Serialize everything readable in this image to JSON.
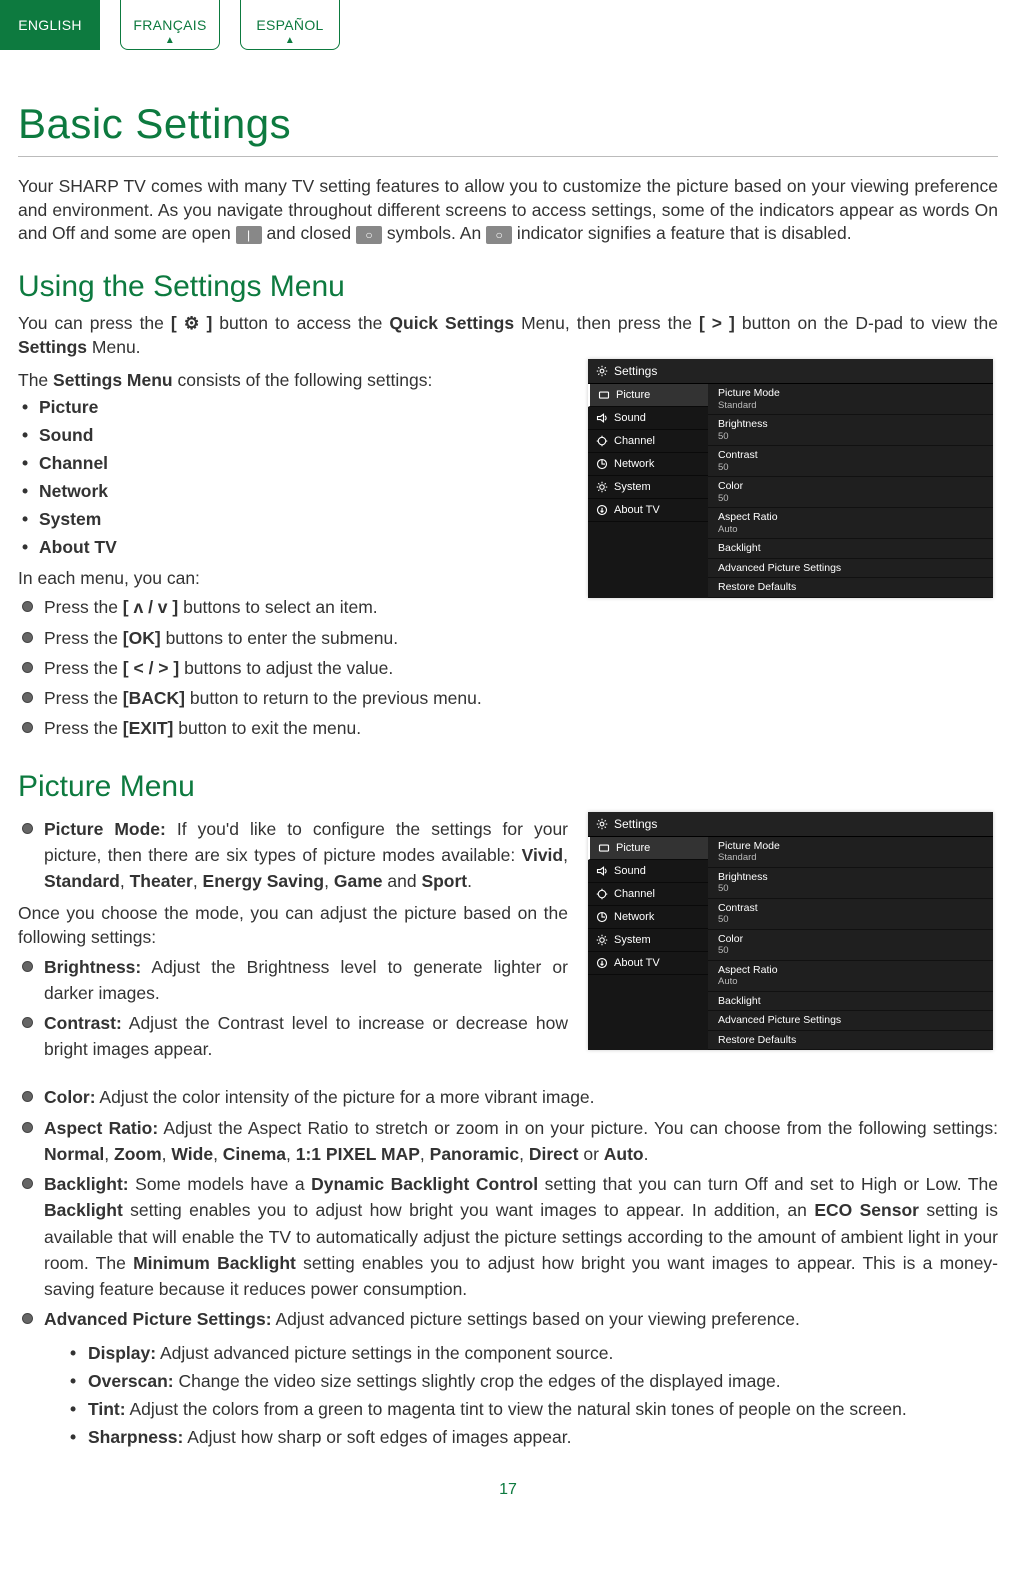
{
  "langs": {
    "en": "ENGLISH",
    "fr": "FRANÇAIS",
    "es": "ESPAÑOL"
  },
  "title": "Basic Settings",
  "intro1a": "Your SHARP TV comes with many TV setting features to allow you to customize the picture based on your viewing preference and environment. As you navigate throughout different screens to access settings, some of the indicators appear as words On and Off and some are open ",
  "intro1b": " and closed ",
  "intro1c": " symbols. An ",
  "intro1d": " indicator signifies a feature that is disabled.",
  "ind_open": "|",
  "ind_closed": "○",
  "ind_disabled": "○",
  "sect1": "Using the Settings Menu",
  "p1a": "You can press the ",
  "p1b": " button to access the ",
  "p1c": " Menu, then press the ",
  "p1d": " button on the D-pad to view the ",
  "p1e": " Menu.",
  "quick": "Quick Settings",
  "rightbtn": "[ > ]",
  "settings_b": "Settings",
  "gear_b": "[ ⚙ ]",
  "p2a": "The ",
  "p2b": "Settings Menu",
  "p2c": " consists of the following settings:",
  "mlist": [
    "Picture",
    "Sound",
    "Channel",
    "Network",
    "System",
    "About TV"
  ],
  "p3": "In each menu, you can:",
  "nav": [
    {
      "a": "Press the ",
      "b": "[ ʌ / v ]",
      "c": " buttons to select an item."
    },
    {
      "a": "Press the ",
      "b": "[OK]",
      "c": " buttons to enter the submenu."
    },
    {
      "a": "Press the ",
      "b": "[ < / > ]",
      "c": " buttons to adjust the value."
    },
    {
      "a": "Press the ",
      "b": "[BACK]",
      "c": " button to return to the previous menu."
    },
    {
      "a": "Press the ",
      "b": "[EXIT]",
      "c": " button to exit the menu."
    }
  ],
  "sect2": "Picture Menu",
  "pm": {
    "a": "Picture Mode:",
    "b": " If you'd like to configure the settings for your picture, then there are six types of picture modes available: ",
    "m1": "Vivid",
    "m2": "Standard",
    "m3": "Theater",
    "m4": "Energy Saving",
    "m5": "Game",
    "m6": "Sport",
    "c": " and ",
    "d": "."
  },
  "p4": "Once you choose the mode, you can adjust the picture based on the following settings:",
  "br": {
    "a": "Brightness:",
    "b": " Adjust the Brightness level to generate lighter or darker images."
  },
  "ct": {
    "a": "Contrast:",
    "b": " Adjust the Contrast level to increase or decrease how bright images appear."
  },
  "cl": {
    "a": "Color:",
    "b": " Adjust the color intensity of the picture for a more vibrant image."
  },
  "ar": {
    "a": "Aspect Ratio:",
    "b": " Adjust the Aspect Ratio to stretch or zoom in on your picture. You can choose from the following settings: ",
    "m1": "Normal",
    "m2": "Zoom",
    "m3": "Wide",
    "m4": "Cinema",
    "m5": "1:1 PIXEL MAP",
    "m6": "Panoramic",
    "m7": "Direct",
    "m8": "Auto",
    "c": " or ",
    "d": "."
  },
  "bl": {
    "a": "Backlight:",
    "b": " Some models have a ",
    "c": "Dynamic Backlight Control",
    "d": " setting that you can turn Off and set to High or Low. The ",
    "e": "Backlight",
    "f": " setting enables you to adjust how bright you want images to appear. In addition, an ",
    "g": "ECO Sensor",
    "h": " setting is available that will enable the TV to automatically adjust the picture settings according to the amount of ambient light in your room. The ",
    "i": "Minimum Backlight",
    "j": " setting enables you to adjust how bright you want images to appear. This is a money-saving feature because it reduces power consumption."
  },
  "aps": {
    "a": "Advanced Picture Settings:",
    "b": " Adjust advanced picture settings based on your viewing preference."
  },
  "sub": [
    {
      "a": "Display:",
      "b": " Adjust advanced picture settings in the component source."
    },
    {
      "a": "Overscan:",
      "b": " Change the video size settings slightly crop the edges of the displayed image."
    },
    {
      "a": "Tint:",
      "b": " Adjust the colors from a green to magenta tint to view the natural skin tones of people on the screen."
    },
    {
      "a": "Sharpness:",
      "b": " Adjust how sharp or soft edges of images appear."
    }
  ],
  "card": {
    "head": "Settings",
    "side": [
      "Picture",
      "Sound",
      "Channel",
      "Network",
      "System",
      "About TV"
    ],
    "main": [
      {
        "l": "Picture Mode",
        "v": "Standard"
      },
      {
        "l": "Brightness",
        "v": "50"
      },
      {
        "l": "Contrast",
        "v": "50"
      },
      {
        "l": "Color",
        "v": "50"
      },
      {
        "l": "Aspect Ratio",
        "v": "Auto"
      },
      {
        "l": "Backlight",
        "v": ""
      },
      {
        "l": "Advanced Picture Settings",
        "v": ""
      },
      {
        "l": "Restore Defaults",
        "v": ""
      }
    ]
  },
  "pagenum": "17"
}
